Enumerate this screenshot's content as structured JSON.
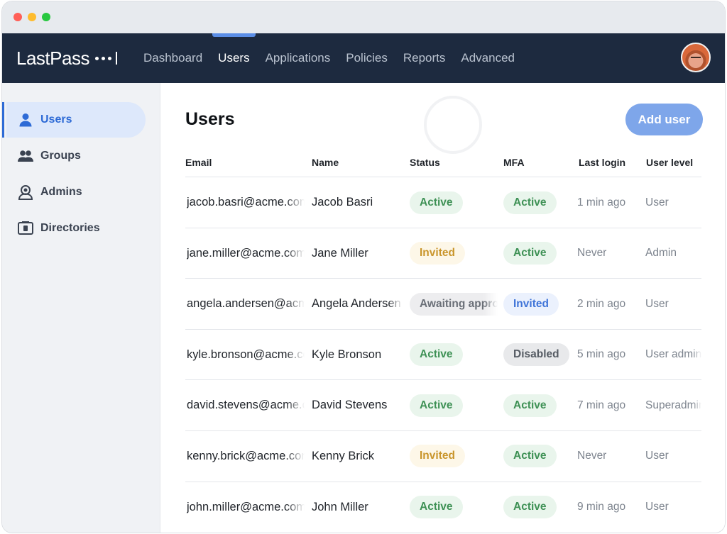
{
  "app": {
    "logo_text": "LastPass"
  },
  "nav": {
    "items": [
      {
        "label": "Dashboard",
        "active": false
      },
      {
        "label": "Users",
        "active": true
      },
      {
        "label": "Applications",
        "active": false
      },
      {
        "label": "Policies",
        "active": false
      },
      {
        "label": "Reports",
        "active": false
      },
      {
        "label": "Advanced",
        "active": false
      }
    ]
  },
  "sidebar": {
    "items": [
      {
        "label": "Users",
        "icon": "user-icon",
        "active": true
      },
      {
        "label": "Groups",
        "icon": "group-icon",
        "active": false
      },
      {
        "label": "Admins",
        "icon": "admin-icon",
        "active": false
      },
      {
        "label": "Directories",
        "icon": "directory-icon",
        "active": false
      }
    ]
  },
  "main": {
    "title": "Users",
    "add_user_label": "Add user"
  },
  "table": {
    "headers": {
      "email": "Email",
      "name": "Name",
      "status": "Status",
      "mfa": "MFA",
      "last_login": "Last login",
      "user_level": "User level"
    },
    "rows": [
      {
        "email": "jacob.basri@acme.com",
        "name": "Jacob Basri",
        "status": "Active",
        "mfa": "Active",
        "last_login": "1 min ago",
        "user_level": "User"
      },
      {
        "email": "jane.miller@acme.com",
        "name": "Jane Miller",
        "status": "Invited",
        "mfa": "Active",
        "last_login": "Never",
        "user_level": "Admin"
      },
      {
        "email": "angela.andersen@acme.com",
        "name": "Angela Andersen",
        "status": "Awaiting approval",
        "mfa": "Invited",
        "last_login": "2 min ago",
        "user_level": "User"
      },
      {
        "email": "kyle.bronson@acme.com",
        "name": "Kyle Bronson",
        "status": "Active",
        "mfa": "Disabled",
        "last_login": "5 min ago",
        "user_level": "User admin"
      },
      {
        "email": "david.stevens@acme.com",
        "name": "David Stevens",
        "status": "Active",
        "mfa": "Active",
        "last_login": "7 min ago",
        "user_level": "Superadmin"
      },
      {
        "email": "kenny.brick@acme.com",
        "name": "Kenny Brick",
        "status": "Invited",
        "mfa": "Active",
        "last_login": "Never",
        "user_level": "User"
      },
      {
        "email": "john.miller@acme.com",
        "name": "John Miller",
        "status": "Active",
        "mfa": "Active",
        "last_login": "9 min ago",
        "user_level": "User"
      }
    ]
  },
  "colors": {
    "nav_bg": "#1d2a3f",
    "accent": "#2e6bd6",
    "button": "#7ea6ea",
    "status_active": "#3e9155",
    "status_invited": "#c9952b"
  }
}
